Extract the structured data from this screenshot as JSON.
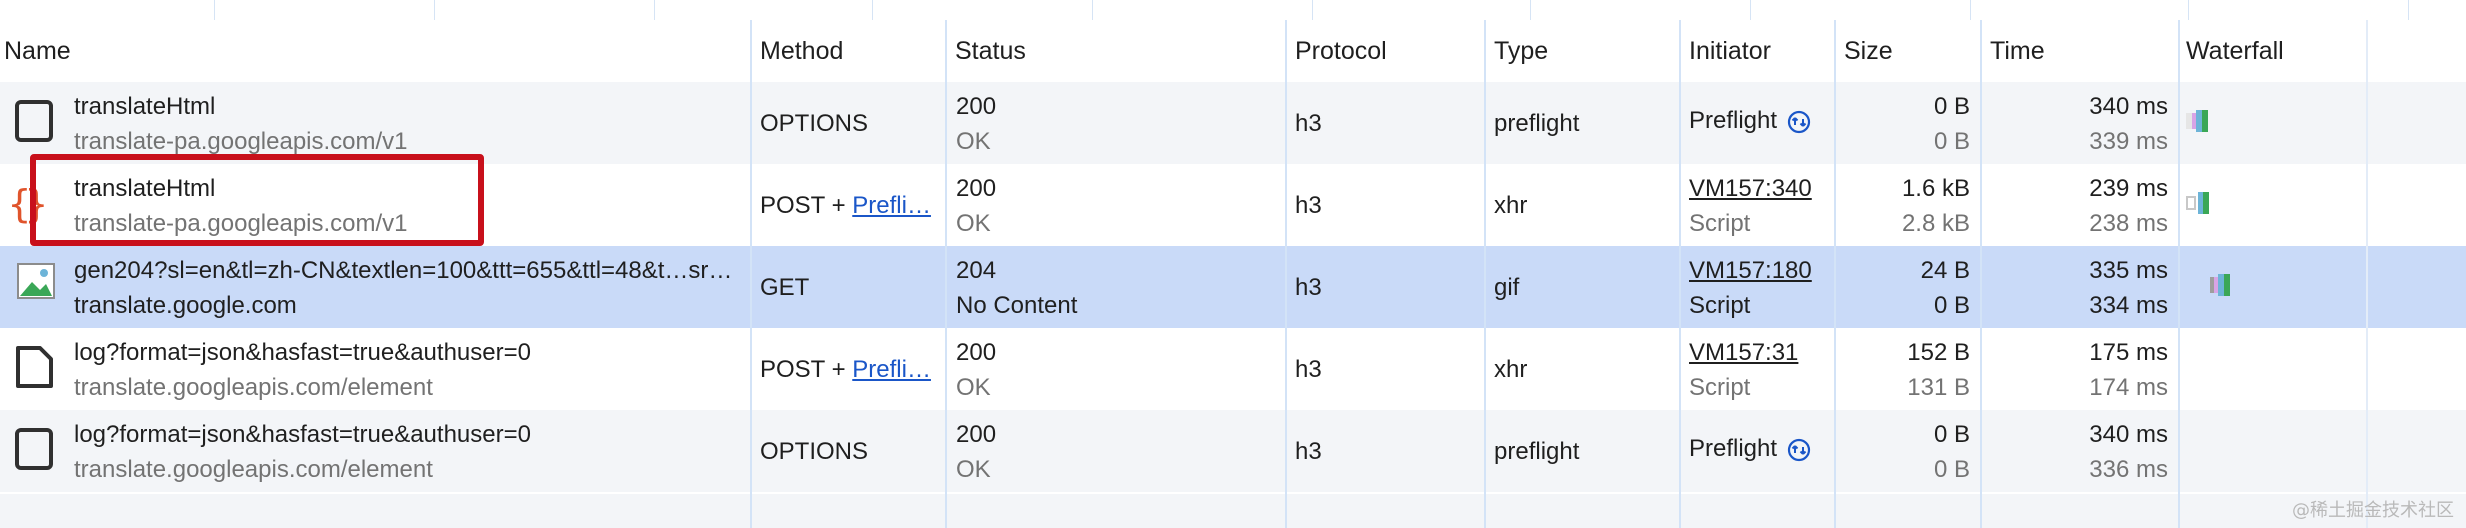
{
  "columns": {
    "name": "Name",
    "method": "Method",
    "status": "Status",
    "protocol": "Protocol",
    "type": "Type",
    "initiator": "Initiator",
    "size": "Size",
    "time": "Time",
    "waterfall": "Waterfall"
  },
  "rows": [
    {
      "name": "translateHtml",
      "domain": "translate-pa.googleapis.com/v1",
      "method": "OPTIONS",
      "status_code": "200",
      "status_text": "OK",
      "protocol": "h3",
      "type": "preflight",
      "initiator": "Preflight",
      "size": "0 B",
      "resource_size": "0 B",
      "time": "340 ms",
      "latency": "339 ms",
      "icon": "blank-document-icon"
    },
    {
      "name": "translateHtml",
      "domain": "translate-pa.googleapis.com/v1",
      "method": "POST + ",
      "method_link": "Prefli…",
      "status_code": "200",
      "status_text": "OK",
      "protocol": "h3",
      "type": "xhr",
      "initiator": "VM157:340",
      "initiator_sub": "Script",
      "size": "1.6 kB",
      "resource_size": "2.8 kB",
      "time": "239 ms",
      "latency": "238 ms",
      "icon": "curly-braces-json-icon"
    },
    {
      "name": "gen204?sl=en&tl=zh-CN&textlen=100&ttt=655&ttl=48&t…sr…",
      "domain": "translate.google.com",
      "method": "GET",
      "status_code": "204",
      "status_text": "No Content",
      "protocol": "h3",
      "type": "gif",
      "initiator": "VM157:180",
      "initiator_sub": "Script",
      "size": "24 B",
      "resource_size": "0 B",
      "time": "335 ms",
      "latency": "334 ms",
      "icon": "image-icon"
    },
    {
      "name": "log?format=json&hasfast=true&authuser=0",
      "domain": "translate.googleapis.com/element",
      "method": "POST + ",
      "method_link": "Prefli…",
      "status_code": "200",
      "status_text": "OK",
      "protocol": "h3",
      "type": "xhr",
      "initiator": "VM157:31",
      "initiator_sub": "Script",
      "size": "152 B",
      "resource_size": "131 B",
      "time": "175 ms",
      "latency": "174 ms",
      "icon": "document-icon"
    },
    {
      "name": "log?format=json&hasfast=true&authuser=0",
      "domain": "translate.googleapis.com/element",
      "method": "OPTIONS",
      "status_code": "200",
      "status_text": "OK",
      "protocol": "h3",
      "type": "preflight",
      "initiator": "Preflight",
      "size": "0 B",
      "resource_size": "0 B",
      "time": "340 ms",
      "latency": "336 ms",
      "icon": "blank-document-icon"
    }
  ],
  "colors": {
    "selected_row": "#c9daf8",
    "link": "#1a56c8",
    "highlight_box": "#c8101b",
    "json_icon": "#e0542c"
  },
  "watermark": "@稀土掘金技术社区"
}
